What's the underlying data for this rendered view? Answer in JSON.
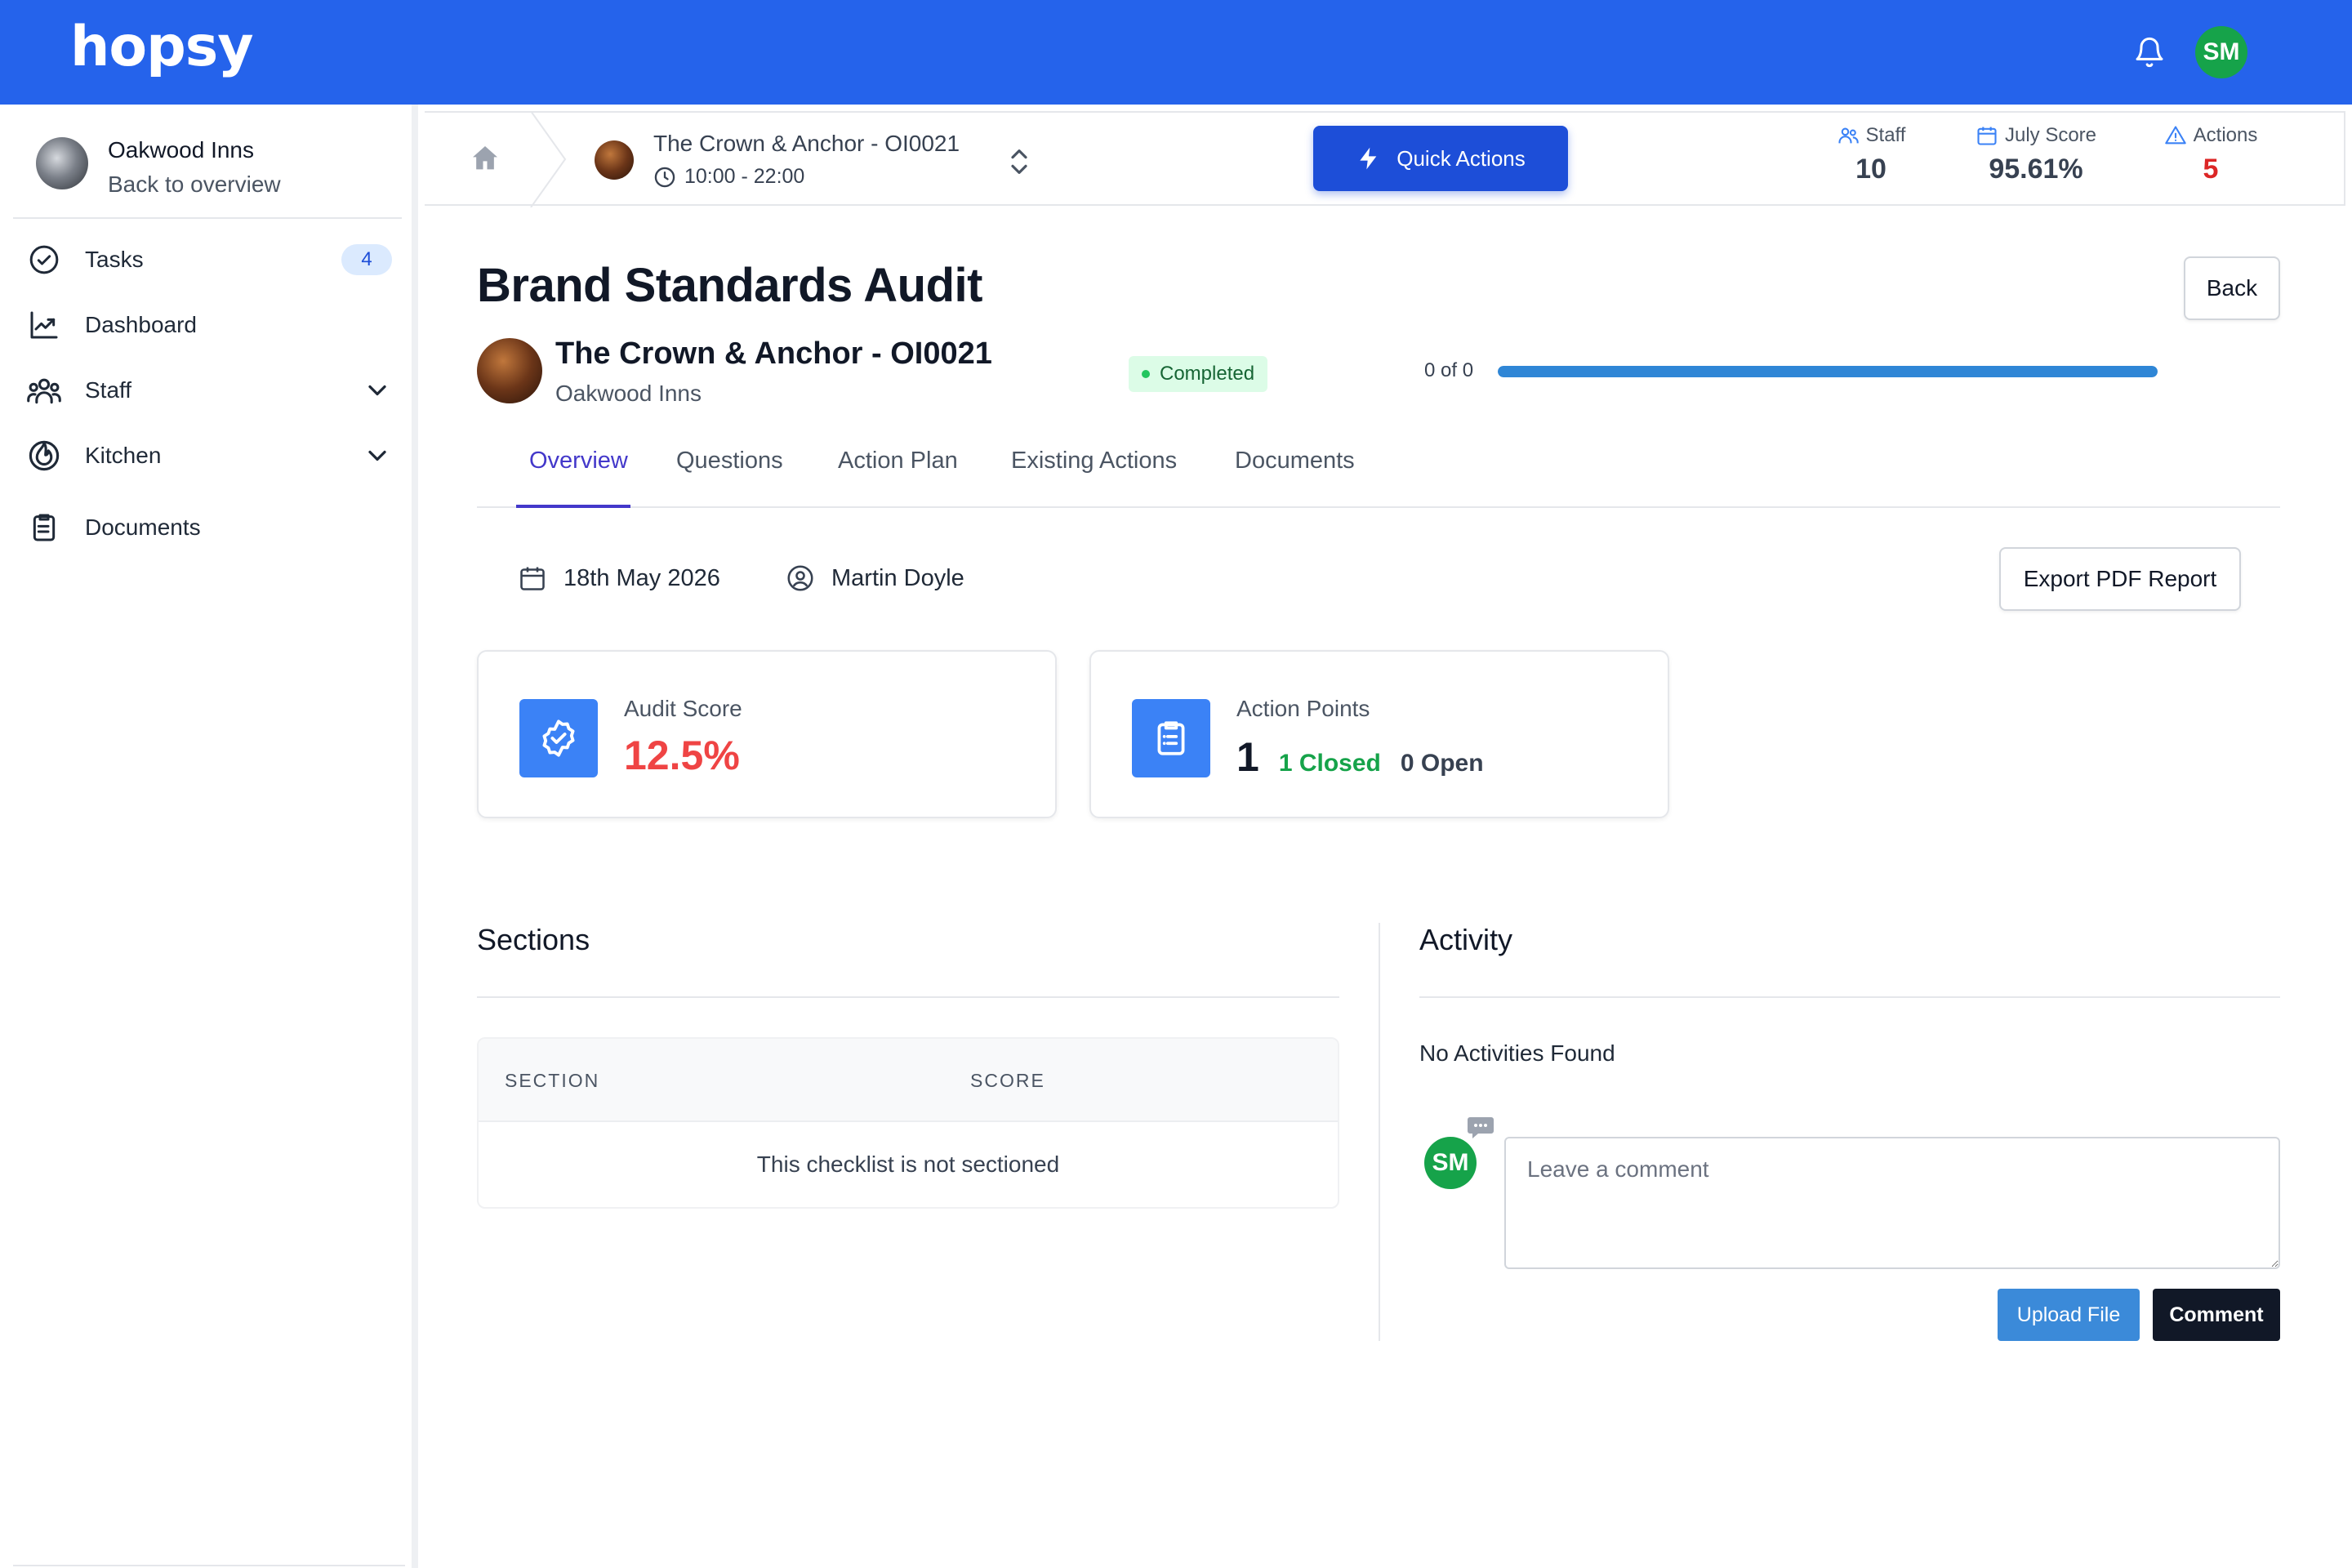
{
  "app": {
    "logo": "hopsy",
    "user_initials": "SM",
    "brand_color": "#2563eb"
  },
  "sidebar": {
    "org_name": "Oakwood Inns",
    "back_label": "Back to overview",
    "items": [
      {
        "label": "Tasks",
        "icon": "check-circle-icon",
        "badge": "4"
      },
      {
        "label": "Dashboard",
        "icon": "chart-line-icon"
      },
      {
        "label": "Staff",
        "icon": "users-icon",
        "expandable": true
      },
      {
        "label": "Kitchen",
        "icon": "flame-icon",
        "expandable": true
      },
      {
        "label": "Documents",
        "icon": "clipboard-icon"
      }
    ]
  },
  "subbar": {
    "venue_name": "The Crown & Anchor - OI0021",
    "hours": "10:00 - 22:00",
    "quick_actions_label": "Quick Actions",
    "stats": [
      {
        "label": "Staff",
        "value": "10",
        "icon": "users-icon"
      },
      {
        "label": "July Score",
        "value": "95.61%",
        "icon": "calendar-icon"
      },
      {
        "label": "Actions",
        "value": "5",
        "icon": "warning-icon",
        "color": "#dc2626"
      }
    ]
  },
  "audit": {
    "title": "Brand Standards Audit",
    "back_label": "Back",
    "venue_name": "The Crown & Anchor - OI0021",
    "org_name": "Oakwood Inns",
    "status": "Completed",
    "progress_label": "0 of 0",
    "progress_fraction": 1.0,
    "tabs": [
      "Overview",
      "Questions",
      "Action Plan",
      "Existing Actions",
      "Documents"
    ],
    "active_tab": "Overview",
    "date": "18th May 2026",
    "auditor": "Martin Doyle",
    "export_label": "Export PDF Report",
    "score_card": {
      "caption": "Audit Score",
      "value": "12.5%",
      "color": "#ef4444"
    },
    "actions_card": {
      "caption": "Action Points",
      "total": "1",
      "closed": "1 Closed",
      "open": "0 Open"
    }
  },
  "sections": {
    "title": "Sections",
    "columns": [
      "SECTION",
      "SCORE"
    ],
    "empty_message": "This checklist is not sectioned"
  },
  "activity": {
    "title": "Activity",
    "empty_message": "No Activities Found",
    "comment_placeholder": "Leave a comment",
    "upload_label": "Upload File",
    "comment_label": "Comment",
    "user_initials": "SM"
  }
}
